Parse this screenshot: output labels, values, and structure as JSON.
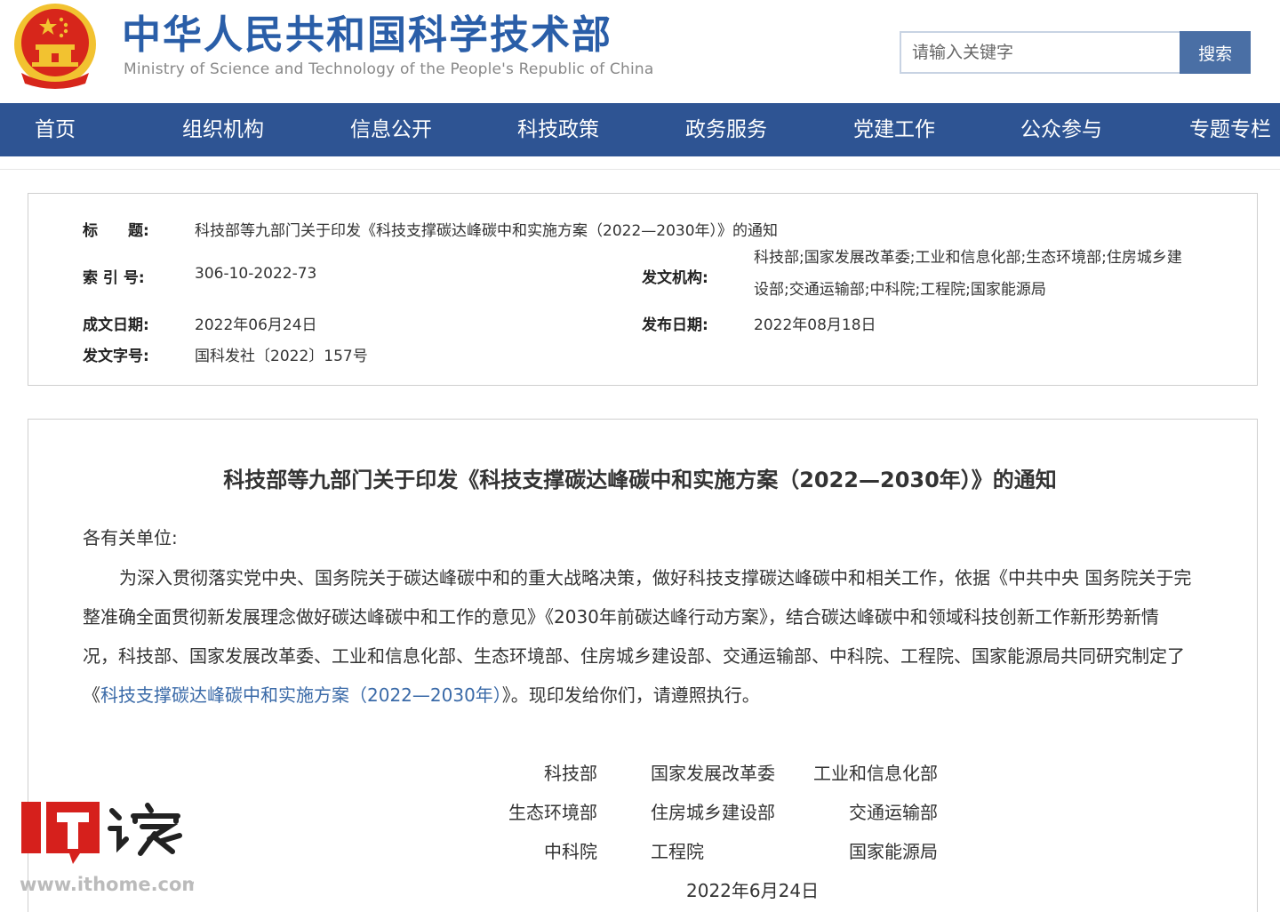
{
  "header": {
    "site_title": "中华人民共和国科学技术部",
    "site_subtitle": "Ministry of Science and Technology of the People's Republic of China",
    "search_placeholder": "请输入关键字",
    "search_button": "搜索"
  },
  "nav": {
    "items": [
      "首页",
      "组织机构",
      "信息公开",
      "科技政策",
      "政务服务",
      "党建工作",
      "公众参与",
      "专题专栏"
    ]
  },
  "meta": {
    "title_label": "标　　题:",
    "title_value": "科技部等九部门关于印发《科技支撑碳达峰碳中和实施方案（2022—2030年）》的通知",
    "index_label": "索 引 号:",
    "index_value": "306-10-2022-73",
    "issuer_label": "发文机构:",
    "issuer_value_line1": "科技部;国家发展改革委;工业和信息化部;生态环境部;住房城乡建",
    "issuer_value_line2": "设部;交通运输部;中科院;工程院;国家能源局",
    "created_label": "成文日期:",
    "created_value": "2022年06月24日",
    "published_label": "发布日期:",
    "published_value": "2022年08月18日",
    "docno_label": "发文字号:",
    "docno_value": "国科发社〔2022〕157号"
  },
  "document": {
    "title": "科技部等九部门关于印发《科技支撑碳达峰碳中和实施方案（2022—2030年）》的通知",
    "salutation": "各有关单位:",
    "line1": "为深入贯彻落实党中央、国务院关于碳达峰碳中和的重大战略决策，做好科技支撑碳达峰碳中和相关工作，依据《中共中央 国务院关于完",
    "line2": "整准确全面贯彻新发展理念做好碳达峰碳中和工作的意见》《2030年前碳达峰行动方案》，结合碳达峰碳中和领域科技创新工作新形势新情",
    "line3": "况，科技部、国家发展改革委、工业和信息化部、生态环境部、住房城乡建设部、交通运输部、中科院、工程院、国家能源局共同研究制定了",
    "line4_prefix": "《",
    "line4_link": "科技支撑碳达峰碳中和实施方案（2022—2030年）",
    "line4_suffix": "》。现印发给你们，请遵照执行。",
    "signatories": [
      "科技部",
      "国家发展改革委",
      "工业和信息化部",
      "生态环境部",
      "住房城乡建设部",
      "交通运输部",
      "中科院",
      "工程院",
      "国家能源局"
    ],
    "date": "2022年6月24日"
  },
  "watermark": {
    "url": "www.ithome.com"
  },
  "colors": {
    "brand_blue": "#2a5ea8",
    "nav_blue": "#2e5493",
    "search_button": "#4a6fa5",
    "link": "#3a6aa8",
    "emblem_red": "#d7261b",
    "emblem_gold": "#f2c230",
    "watermark_red": "#d6201c"
  }
}
